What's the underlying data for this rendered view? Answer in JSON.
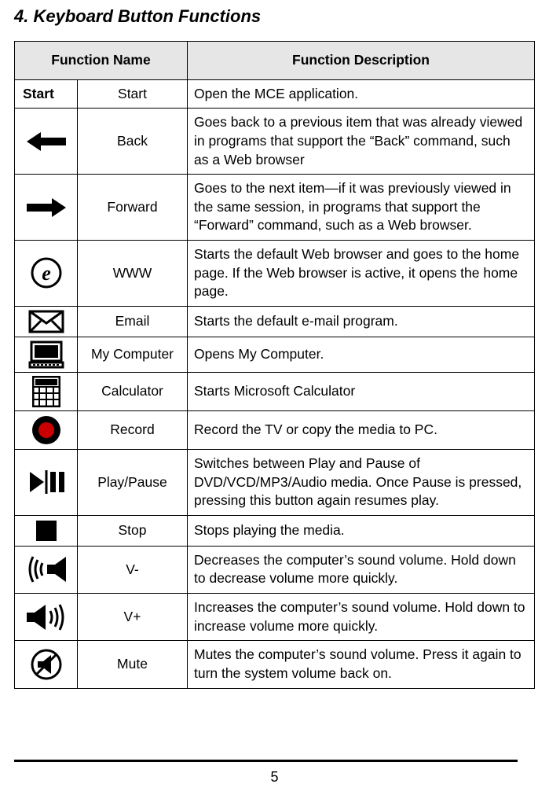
{
  "heading": "4. Keyboard Button Functions",
  "headers": {
    "name": "Function Name",
    "desc": "Function Description"
  },
  "rows": [
    {
      "icon": "start-text",
      "icon_label": "Start",
      "name": "Start",
      "desc": "Open the MCE application."
    },
    {
      "icon": "back-arrow",
      "name": "Back",
      "desc": "Goes back to a previous item that was already viewed in programs that support the “Back” command, such as a Web browser"
    },
    {
      "icon": "forward-arrow",
      "name": "Forward",
      "desc": "Goes to the next item—if it was previously viewed in the same session, in programs that support the “Forward” command, such as a Web browser."
    },
    {
      "icon": "www-e",
      "name": "WWW",
      "desc": "Starts the default Web browser and goes to the home page. If the Web browser is active, it opens the home page."
    },
    {
      "icon": "email-envelope",
      "name": "Email",
      "desc": "Starts the default e-mail program."
    },
    {
      "icon": "my-computer",
      "name": "My Computer",
      "desc": "Opens My Computer."
    },
    {
      "icon": "calculator-grid",
      "name": "Calculator",
      "desc": "Starts Microsoft Calculator"
    },
    {
      "icon": "record-dot",
      "name": "Record",
      "desc": "Record the TV or copy the media to PC."
    },
    {
      "icon": "play-pause",
      "name": "Play/Pause",
      "desc": "Switches between Play and Pause of DVD/VCD/MP3/Audio media. Once Pause is pressed, pressing this button again resumes play."
    },
    {
      "icon": "stop-square",
      "name": "Stop",
      "desc": "Stops playing the media."
    },
    {
      "icon": "volume-down",
      "name": "V-",
      "desc": "Decreases the computer’s sound volume. Hold down to decrease volume more quickly."
    },
    {
      "icon": "volume-up",
      "name": "V+",
      "desc": "Increases the computer’s sound volume. Hold down to increase volume more quickly."
    },
    {
      "icon": "mute-speaker",
      "name": "Mute",
      "desc": "Mutes the computer’s sound volume. Press it again to turn the system volume back on."
    }
  ],
  "page_number": "5"
}
